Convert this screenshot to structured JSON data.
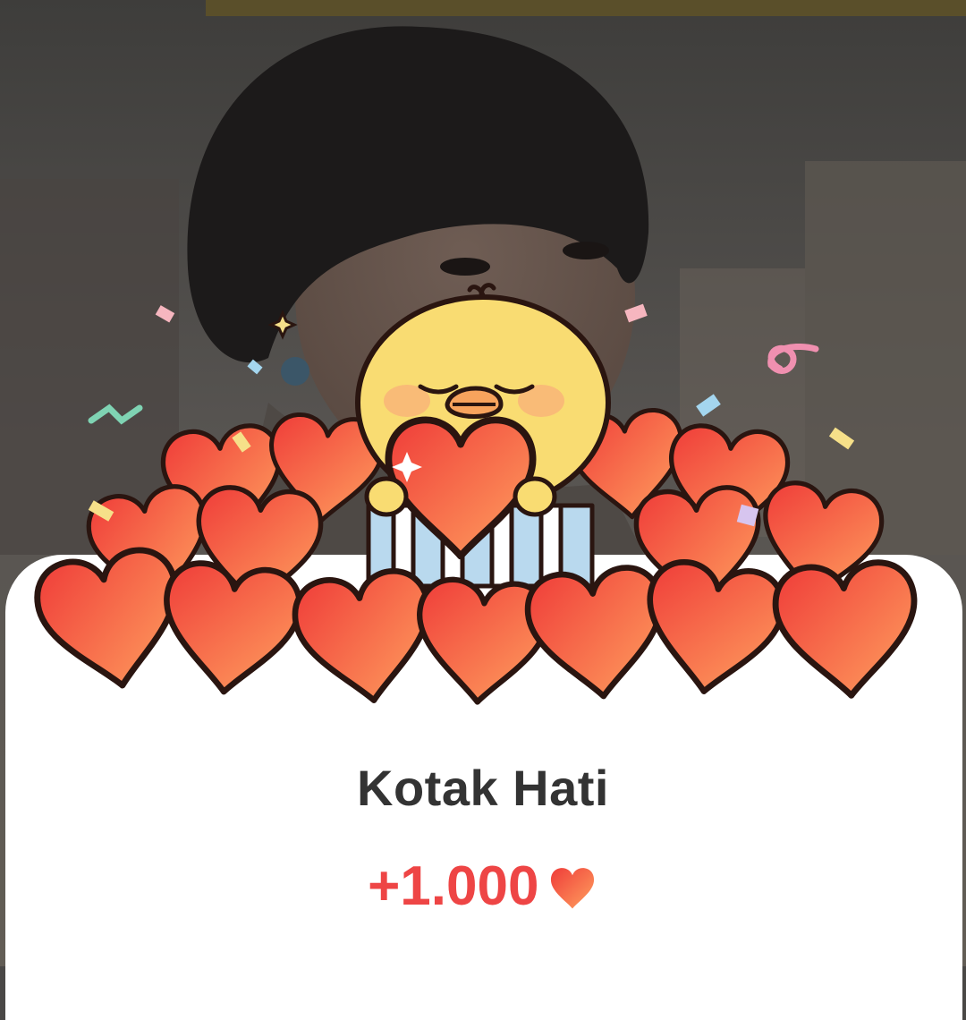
{
  "popup": {
    "title": "Kotak Hati",
    "reward_amount": "+1.000",
    "reward_icon": "heart-icon"
  },
  "illustration": {
    "character": "yellow-chick-mascot",
    "item": "heart-box"
  },
  "colors": {
    "heart_red": "#f0453d",
    "heart_orange": "#ff9a5c",
    "accent_text": "#ee4545",
    "title_text": "#333333",
    "chick_yellow": "#f9dc72",
    "box_blue": "#b9d9ee"
  }
}
